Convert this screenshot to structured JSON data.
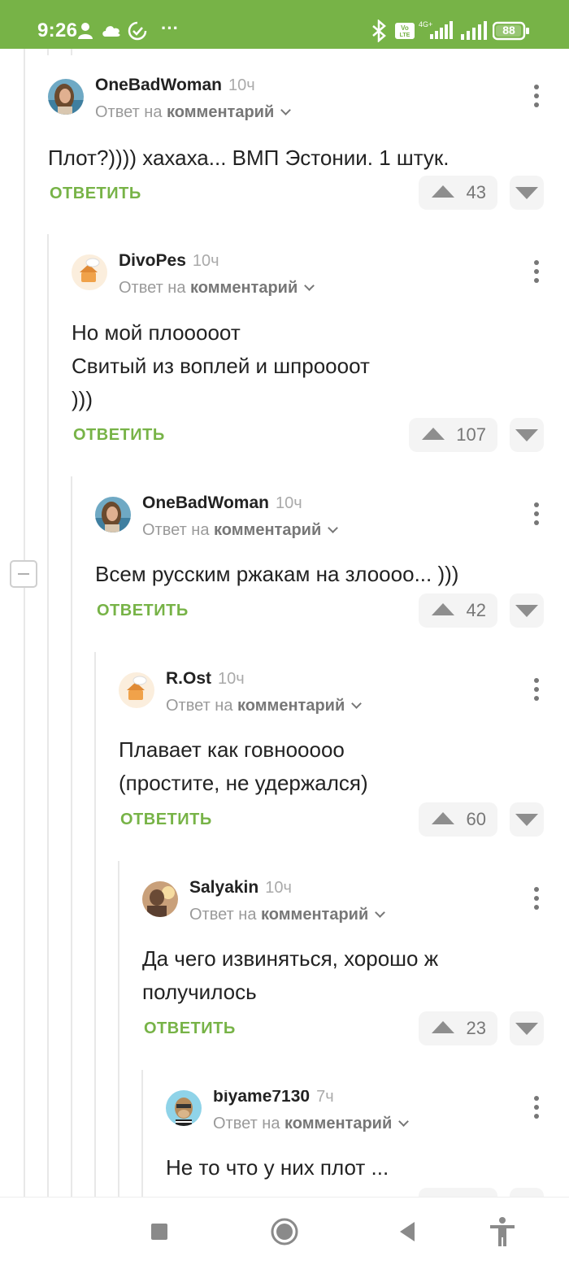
{
  "status": {
    "time": "9:26",
    "battery": "88",
    "network_label": "4G+",
    "volte": "Vo LTE"
  },
  "colors": {
    "accent": "#77b347",
    "muted": "#9a9a9a"
  },
  "comments": [
    {
      "author": "OneBadWoman",
      "time": "10ч",
      "reply_prefix": "Ответ на",
      "reply_target": "комментарий",
      "text": "Плот?)))) хахаха... ВМП Эстонии. 1 штук.",
      "reply_label": "ОТВЕТИТЬ",
      "votes": "43",
      "avatar": "woman-photo"
    },
    {
      "author": "DivoPes",
      "time": "10ч",
      "reply_prefix": "Ответ на",
      "reply_target": "комментарий",
      "text": "Но мой плооооот\nСвитый из воплей и шпроооот\n)))",
      "reply_label": "ОТВЕТИТЬ",
      "votes": "107",
      "avatar": "default-cartoon"
    },
    {
      "author": "OneBadWoman",
      "time": "10ч",
      "reply_prefix": "Ответ на",
      "reply_target": "комментарий",
      "text": "Всем русским ржакам на злоооо... )))",
      "reply_label": "ОТВЕТИТЬ",
      "votes": "42",
      "avatar": "woman-photo"
    },
    {
      "author": "R.Ost",
      "time": "10ч",
      "reply_prefix": "Ответ на",
      "reply_target": "комментарий",
      "text": "Плавает как говноoooo\n(простите, не удержался)",
      "reply_label": "ОТВЕТИТЬ",
      "votes": "60",
      "avatar": "default-cartoon"
    },
    {
      "author": "Salyakin",
      "time": "10ч",
      "reply_prefix": "Ответ на",
      "reply_target": "комментарий",
      "text": "Да чего извиняться, хорошо ж\nполучилось",
      "reply_label": "ОТВЕТИТЬ",
      "votes": "23",
      "avatar": "man-photo"
    },
    {
      "author": "biyame7130",
      "time": "7ч",
      "reply_prefix": "Ответ на",
      "reply_target": "комментарий",
      "text": "Не то что у них плот ...",
      "avatar": "ape-cartoon"
    }
  ]
}
